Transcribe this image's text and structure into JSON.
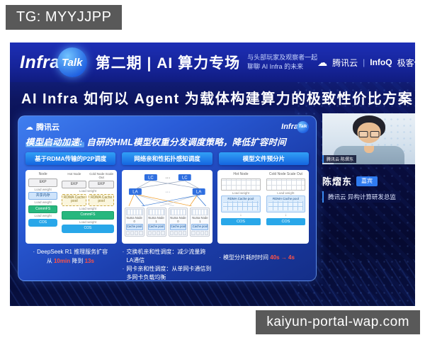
{
  "overlays": {
    "top_left": "TG: MYYJJPP",
    "bottom_right": "kaiyun-portal-wap.com"
  },
  "icons": {
    "cloud": "☁",
    "arrow_down": "↓",
    "dot": "·"
  },
  "header": {
    "logo_infra": "Infra",
    "logo_talk": "Talk",
    "episode": "第二期 | AI 算力专场",
    "tagline_line1": "与头部玩家及观察者一起",
    "tagline_line2": "聊聊 AI Infra 的未来",
    "brand_left": "腾讯云",
    "brand_sep": "|",
    "brand_infoq": "InfoQ",
    "brand_right": "极客传媒"
  },
  "main_title": "AI Infra 如何以 Agent 为载体构建算力的极致性价比方案",
  "slide": {
    "brand": "腾讯云",
    "logo_infra": "Infra",
    "logo_talk": "Talk",
    "heading_em": "模型启动加速:",
    "heading_rest": " 自研的HML模型权重分发调度策略，降低扩容时间",
    "tabs": [
      "基于RDMA传输的P2P调度",
      "网络亲和性拓扑感知调度",
      "模型文件预分片"
    ],
    "panel1": {
      "col1_title": "Node",
      "ekp": "EKP",
      "lw": "Load weight",
      "mem": "共享内存",
      "fs": "CommFS",
      "cos": "COS",
      "hot_title": "Hot Node",
      "cold_title": "Cold Node Scale Out",
      "cache": "RDMA Cache pool"
    },
    "panel2": {
      "lc": "LC",
      "la": "LA",
      "dots": "···",
      "rack_labels": [
        "Numa Node 0",
        "Numa Node 1",
        "Numa Node 0",
        "Numa Node 1"
      ],
      "cache_label": "Cache pool"
    },
    "panel3": {
      "hot_title": "Hot Node",
      "cold_title": "Cold Node Scale Out",
      "lw": "Load weight",
      "cache": "RDMA Cache pool",
      "cos": "COS"
    },
    "bullets": {
      "dot": "·",
      "b1_line1": "DeepSeek R1 推理服务扩容",
      "b1_pre": "从 ",
      "b1_red1": "10min",
      "b1_mid": " 降到 ",
      "b1_red2": "13s",
      "b2": "交换机亲和性调度：减少流量跨LA通信",
      "b3": "网卡亲和性调度：从单网卡通信到多网卡负载均衡",
      "b4_main": "模型分片耗时时间 ",
      "b4_red": "40s → 4s"
    }
  },
  "speaker": {
    "caption": "腾讯云·陈熠东",
    "name": "陈熠东",
    "badge": "嘉宾",
    "title": "腾讯云 异构计算研发总监"
  },
  "colors": {
    "overlay_gray": "#595959",
    "frame_blue": "#1827a6",
    "tab_blue": "#1f7ef0",
    "cos_blue": "#29a7e9",
    "commfs_green": "#27b77e",
    "highlight_red": "#ff5347",
    "badge_blue": "#2f7bf0"
  }
}
